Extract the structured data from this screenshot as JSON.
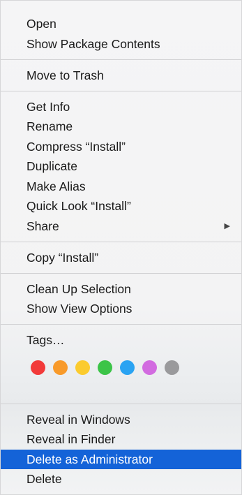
{
  "menu": {
    "groups": [
      {
        "items": [
          {
            "label": "Open"
          },
          {
            "label": "Show Package Contents"
          }
        ]
      },
      {
        "items": [
          {
            "label": "Move to Trash"
          }
        ]
      },
      {
        "items": [
          {
            "label": "Get Info"
          },
          {
            "label": "Rename"
          },
          {
            "label": "Compress “Install”"
          },
          {
            "label": "Duplicate"
          },
          {
            "label": "Make Alias"
          },
          {
            "label": "Quick Look “Install”"
          },
          {
            "label": "Share"
          }
        ]
      },
      {
        "items": [
          {
            "label": "Copy “Install”"
          }
        ]
      },
      {
        "items": [
          {
            "label": "Clean Up Selection"
          },
          {
            "label": "Show View Options"
          }
        ]
      },
      {
        "items": [
          {
            "label": "Tags…"
          }
        ]
      },
      {
        "items": [
          {
            "label": "Reveal in Windows"
          },
          {
            "label": "Reveal in Finder"
          },
          {
            "label": "Delete as Administrator",
            "highlighted": true
          },
          {
            "label": "Delete"
          }
        ]
      }
    ],
    "submenu_arrow_icon": "submenu-arrow-icon",
    "tags": [
      {
        "color_name": "red",
        "color": "#f23a3a"
      },
      {
        "color_name": "orange",
        "color": "#f89a2a"
      },
      {
        "color_name": "yellow",
        "color": "#fbcb2e"
      },
      {
        "color_name": "green",
        "color": "#3cc448"
      },
      {
        "color_name": "blue",
        "color": "#2aa3f2"
      },
      {
        "color_name": "purple",
        "color": "#d26be0"
      },
      {
        "color_name": "gray",
        "color": "#9a9a9c"
      }
    ],
    "accent_color": "#1463d8"
  }
}
